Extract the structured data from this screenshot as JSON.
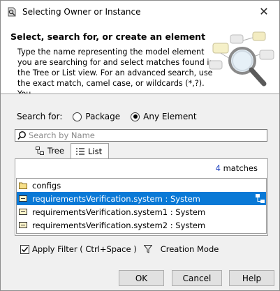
{
  "window": {
    "title": "Selecting Owner or Instance",
    "close_glyph": "✕"
  },
  "header": {
    "title": "Select, search for, or create an element",
    "description": "Type the name representing the model element\nyou are searching for and select matches found in\nthe Tree or List view. For an advanced search, use\nthe exact match, camel case, or wildcards (*,?). You"
  },
  "search_for": {
    "label": "Search for:",
    "options": [
      {
        "label": "Package",
        "selected": false
      },
      {
        "label": "Any Element",
        "selected": true
      }
    ]
  },
  "search": {
    "placeholder": "Search by Name",
    "value": ""
  },
  "tabs": [
    {
      "label": "Tree",
      "active": false
    },
    {
      "label": "List",
      "active": true
    }
  ],
  "results": {
    "count": "4",
    "count_suffix": "matches",
    "items": [
      {
        "label": "configs",
        "icon": "folder-icon",
        "selected": false
      },
      {
        "label": "requirementsVerification.system : System",
        "icon": "instance-icon",
        "selected": true
      },
      {
        "label": "requirementsVerification.system1 : System",
        "icon": "instance-icon",
        "selected": false
      },
      {
        "label": "requirementsVerification.system2 : System",
        "icon": "instance-icon",
        "selected": false
      }
    ]
  },
  "filter": {
    "checked": true,
    "label": "Apply Filter ( Ctrl+Space )",
    "creation_mode": "Creation Mode"
  },
  "buttons": {
    "ok": "OK",
    "cancel": "Cancel",
    "help": "Help"
  },
  "colors": {
    "selection": "#0a79d6",
    "match_count": "#1a3fbf",
    "folder": "#e8c45a"
  }
}
